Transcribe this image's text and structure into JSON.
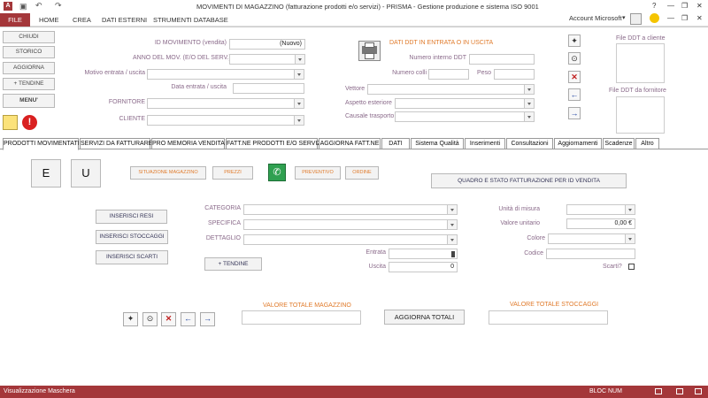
{
  "titlebar": {
    "title": "MOVIMENTI DI MAGAZZINO (fatturazione prodotti e/o servizi)  -  PRISMA - Gestione produzione e sistema ISO 9001",
    "help": "?",
    "minimize": "—",
    "restore": "❐",
    "close": "✕"
  },
  "ribbon": {
    "file": "FILE",
    "tabs": [
      "HOME",
      "CREA",
      "DATI ESTERNI",
      "STRUMENTI DATABASE"
    ],
    "account": "Account Microsoft"
  },
  "side_buttons": [
    "CHIUDI",
    "STORICO",
    "AGGIORNA",
    "+ TENDINE",
    "MENU'"
  ],
  "header_form": {
    "id_label": "ID MOVIMENTO (vendita)",
    "id_value": "(Nuovo)",
    "anno_label": "ANNO DEL MOV.  (E/O DEL SERV.)",
    "motivo_label": "Motivo entrata / uscita",
    "data_label": "Data entrata / uscita",
    "fornitore_label": "FORNITORE",
    "cliente_label": "CLIENTE"
  },
  "ddt": {
    "title": "DATI DDT IN ENTRATA O IN USCITA",
    "numero_label": "Numero interno DDT",
    "colli_label": "Numero colli",
    "peso_label": "Peso",
    "vettore_label": "Vettore",
    "aspetto_label": "Aspetto esteriore",
    "causale_label": "Causale trasporto",
    "file_cliente": "File DDT a cliente",
    "file_fornitore": "File DDT da fornitore"
  },
  "tabs": [
    "PRODOTTI MOVIMENTATI",
    "SERVIZI DA FATTURARE",
    "PRO MEMORIA VENDITA",
    "FATT.NE PRODOTTI E/O SERVIZI",
    "AGGIORNA FATT.NE",
    "DATI",
    "Sistema Qualità",
    "Inserimenti",
    "Consultazioni",
    "Aggiornamenti",
    "Scadenze",
    "Altro"
  ],
  "content": {
    "e_btn": "E",
    "u_btn": "U",
    "situazione": "SITUAZIONE MAGAZZINO",
    "prezzi": "PREZZI",
    "preventivo": "PREVENTIVO",
    "ordine": "ORDINE",
    "quadro": "QUADRO E STATO FATTURAZIONE PER ID VENDITA",
    "inserisci_resi": "INSERISCI RESI",
    "inserisci_stoccaggi": "INSERISCI STOCCAGGI",
    "inserisci_scarti": "INSERISCI SCARTI",
    "tendine": "+ TENDINE",
    "categoria": "CATEGORIA",
    "specifica": "SPECIFICA",
    "dettaglio": "DETTAGLIO",
    "entrata": "Entrata",
    "uscita": "Uscita",
    "uscita_value": "0",
    "unita": "Unità di misura",
    "valore_unitario": "Valore unitario",
    "valore_unitario_value": "0,00 €",
    "colore": "Colore",
    "codice": "Codice",
    "scarti": "Scarti?",
    "valore_totale_mag": "VALORE TOTALE MAGAZZINO",
    "aggiorna_totali": "AGGIORNA TOTALI",
    "valore_totale_stoc": "VALORE TOTALE STOCCAGGI"
  },
  "statusbar": {
    "left": "Visualizzazione Maschera",
    "right": "BLOC NUM"
  },
  "colors": {
    "accent": "#a4373a",
    "orange": "#e07a2a",
    "label": "#8a6a8a"
  }
}
